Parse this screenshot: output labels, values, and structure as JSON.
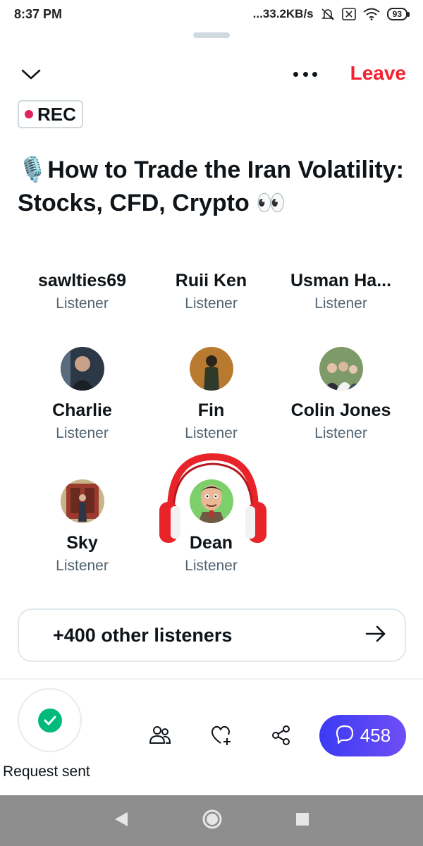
{
  "status_bar": {
    "time": "8:37 PM",
    "network_speed": "...33.2KB/s",
    "battery": "93",
    "icons": [
      "mute-icon",
      "no-sim-icon",
      "wifi-icon",
      "battery-icon"
    ]
  },
  "header": {
    "leave_label": "Leave",
    "rec_label": "REC"
  },
  "space": {
    "title": "🎙️How to Trade the Iran Volatility: Stocks, CFD, Crypto 👀"
  },
  "participants": [
    {
      "name": "sawlties69",
      "role": "Listener",
      "avatar": false
    },
    {
      "name": "Ruii Ken",
      "role": "Listener",
      "avatar": false
    },
    {
      "name": "Usman Ha...",
      "role": "Listener",
      "avatar": false
    },
    {
      "name": "Charlie",
      "role": "Listener",
      "avatar": true,
      "avatar_color": "#3a4a5c"
    },
    {
      "name": "Fin",
      "role": "Listener",
      "avatar": true,
      "avatar_color": "#b5782e"
    },
    {
      "name": "Colin Jones",
      "role": "Listener",
      "avatar": true,
      "avatar_color": "#6b8a5a"
    },
    {
      "name": "Sky",
      "role": "Listener",
      "avatar": true,
      "avatar_color": "#8c6a4a"
    },
    {
      "name": "Dean",
      "role": "Listener",
      "avatar": true,
      "avatar_color": "#7ccf6a",
      "speaking": true
    }
  ],
  "listeners_button": {
    "label": "+400 other listeners"
  },
  "footer": {
    "request_label": "Request sent",
    "reply_count": "458"
  },
  "colors": {
    "accent_red": "#f4212e",
    "rec_dot": "#e0245e",
    "check_green": "#00ba7c",
    "reply_gradient_start": "#3b3bf4",
    "reply_gradient_end": "#6f4ef6",
    "headphone_red": "#e8242a"
  }
}
